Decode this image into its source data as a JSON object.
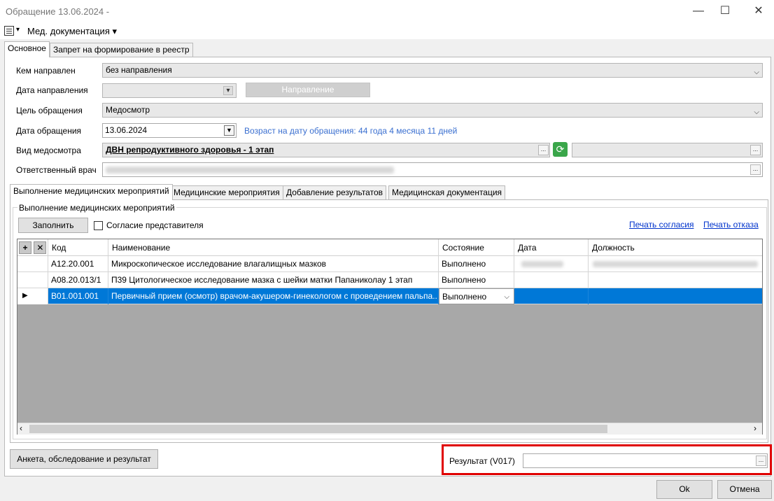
{
  "window": {
    "title": "Обращение 13.06.2024 -",
    "minimize": "—",
    "maximize": "☐",
    "close": "✕"
  },
  "menu": {
    "icon_dropdown": "▾",
    "med_docs": "Мед. документация ▾"
  },
  "top_tabs": [
    {
      "label": "Основное",
      "active": true
    },
    {
      "label": "Запрет на формирование в реестр",
      "active": false
    }
  ],
  "form": {
    "directed_by_label": "Кем направлен",
    "directed_by_value": "без направления",
    "direction_date_label": "Дата направления",
    "direction_button": "Направление",
    "purpose_label": "Цель обращения",
    "purpose_value": "Медосмотр",
    "visit_date_label": "Дата обращения",
    "visit_date_value": "13.06.2024",
    "age_note": "Возраст на дату обращения:  44 года 4 месяца 11 дней",
    "exam_type_label": "Вид медосмотра",
    "exam_type_value": "ДВН репродуктивного здоровья - 1 этап",
    "doctor_label": "Ответственный врач"
  },
  "inner_tabs": [
    {
      "label": "Выполнение медицинских мероприятий",
      "active": true
    },
    {
      "label": "Медицинские мероприятия",
      "active": false
    },
    {
      "label": "Добавление результатов",
      "active": false
    },
    {
      "label": "Медицинская документация",
      "active": false
    }
  ],
  "group": {
    "title": "Выполнение медицинских мероприятий",
    "fill_button": "Заполнить",
    "consent_checkbox": "Согласие представителя",
    "print_consent": "Печать согласия",
    "print_refusal": "Печать отказа"
  },
  "grid": {
    "columns": [
      "Код",
      "Наименование",
      "Состояние",
      "Дата",
      "Должность"
    ],
    "rows": [
      {
        "code": "A12.20.001",
        "name": "Микроскопическое исследование влагалищных мазков",
        "state": "Выполнено",
        "selected": false
      },
      {
        "code": "A08.20.013/1",
        "name": "П39 Цитологическое исследование мазка с шейки матки Папаниколау  1 этап",
        "state": "Выполнено",
        "selected": false
      },
      {
        "code": "B01.001.001",
        "name": "Первичный прием (осмотр) врачом-акушером-гинекологом с проведением пальпа...",
        "state": "Выполнено",
        "selected": true
      }
    ]
  },
  "bottom": {
    "survey_button": "Анкета, обследование и результат",
    "result_label": "Результат (V017)",
    "ok_button": "Ok",
    "cancel_button": "Отмена"
  },
  "colors": {
    "selection": "#0078d7",
    "highlight_border": "#e00000",
    "link": "#0033cc"
  }
}
